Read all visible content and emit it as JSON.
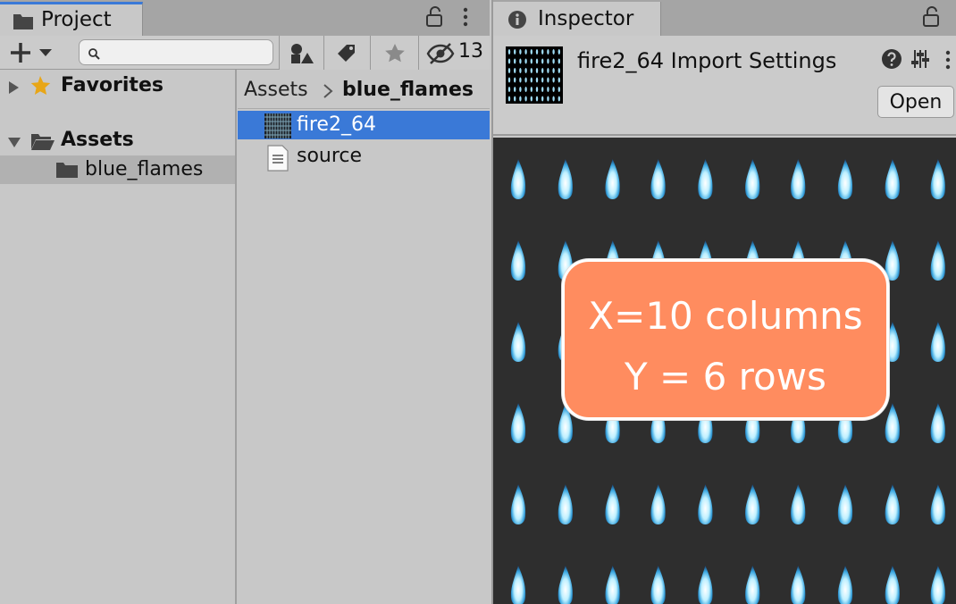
{
  "project": {
    "tab_label": "Project",
    "search": {
      "placeholder": "",
      "value": ""
    },
    "hidden_packages_count": "13",
    "tree": {
      "favorites_label": "Favorites",
      "assets_label": "Assets",
      "subfolder_label": "blue_flames"
    },
    "breadcrumb": {
      "root": "Assets",
      "current": "blue_flames"
    },
    "files": [
      {
        "name": "fire2_64",
        "selected": true,
        "icon": "texture-thumbnail"
      },
      {
        "name": "source",
        "selected": false,
        "icon": "document-icon"
      }
    ]
  },
  "inspector": {
    "tab_label": "Inspector",
    "asset_title": "fire2_64 Import Settings",
    "open_button": "Open",
    "preview": {
      "grid_columns": 10,
      "grid_rows": 6
    },
    "annotation": {
      "line1": "X=10 columns",
      "line2": "Y = 6 rows"
    }
  },
  "colors": {
    "selection": "#3a79d7",
    "annotation_fill": "#ff8c5f",
    "preview_bg": "#2e2e2e",
    "favorites_star": "#e8a617"
  }
}
